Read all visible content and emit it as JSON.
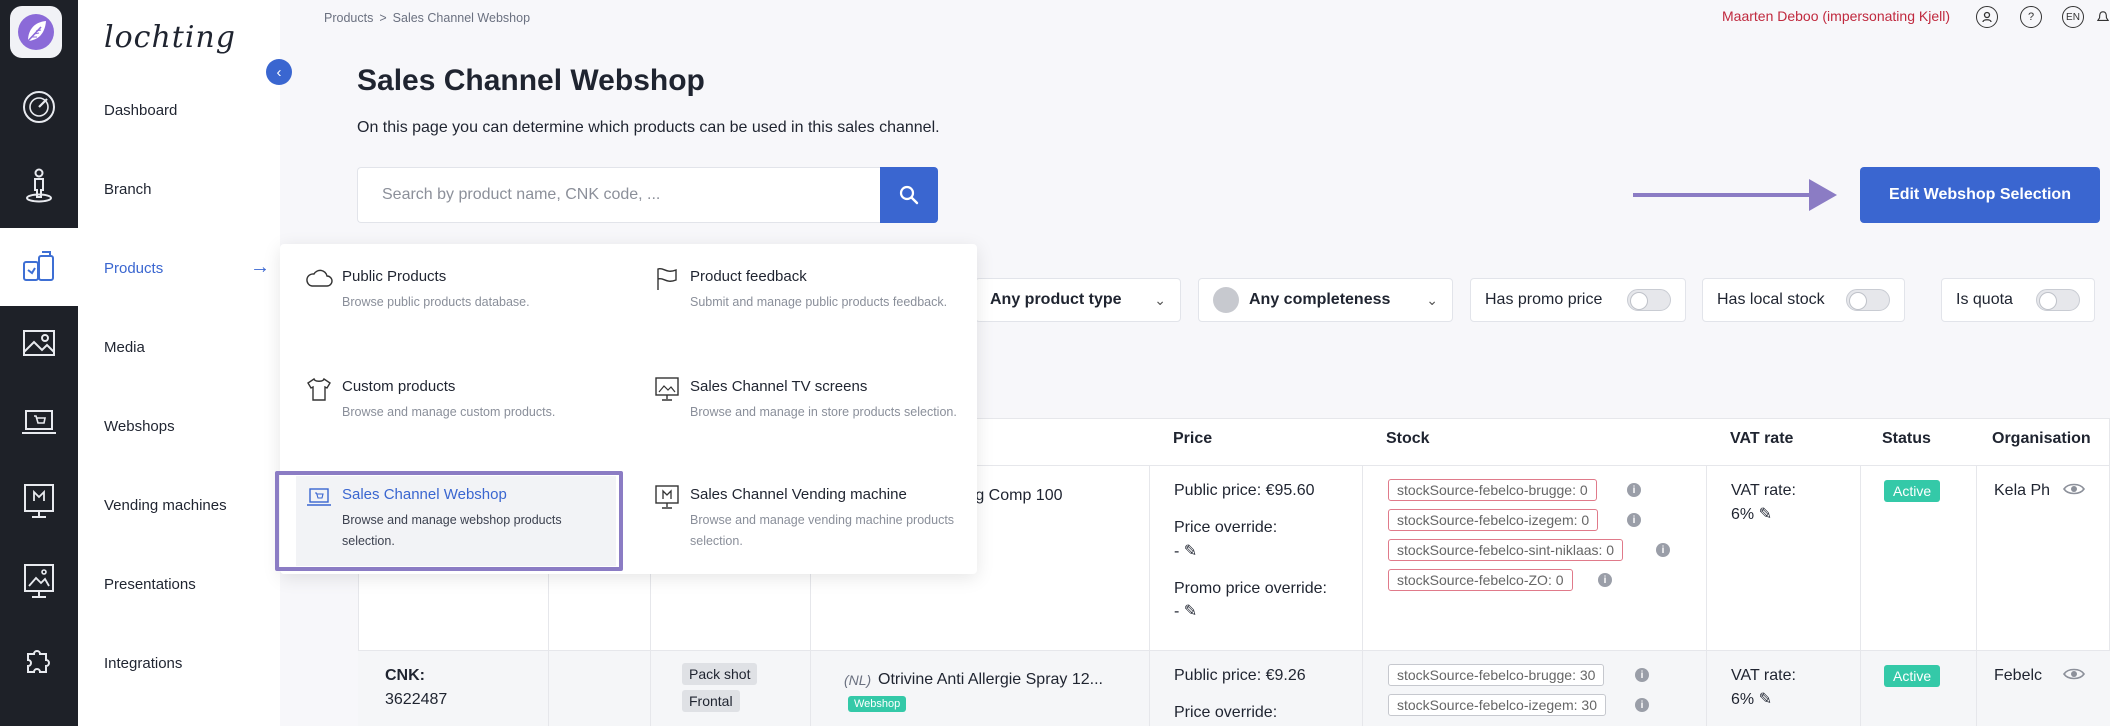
{
  "rail": {
    "icons": [
      "dashboard-gauge-icon",
      "branch-person-icon",
      "products-box-icon",
      "media-image-icon",
      "webshop-laptop-cart-icon",
      "vending-machine-icon",
      "presentation-board-icon",
      "integrations-puzzle-icon"
    ],
    "active_index": 2
  },
  "brand": "lochting",
  "nav": {
    "items": [
      {
        "label": "Dashboard"
      },
      {
        "label": "Branch"
      },
      {
        "label": "Products"
      },
      {
        "label": "Media"
      },
      {
        "label": "Webshops"
      },
      {
        "label": "Vending machines"
      },
      {
        "label": "Presentations"
      },
      {
        "label": "Integrations"
      }
    ],
    "active": "Products"
  },
  "breadcrumb": {
    "parent": "Products",
    "separator": ">",
    "current": "Sales Channel Webshop"
  },
  "topbar": {
    "user": "Maarten Deboo (impersonating Kjell)",
    "help": "?",
    "lang": "EN"
  },
  "page": {
    "title": "Sales Channel Webshop",
    "description": "On this page you can determine which products can be used in this sales channel.",
    "search_placeholder": "Search by product name, CNK code, ...",
    "edit_button": "Edit Webshop Selection"
  },
  "filters": {
    "product_type": "Any product type",
    "completeness": "Any completeness",
    "promo": "Has promo price",
    "local_stock": "Has local stock",
    "quota": "Is quota"
  },
  "dropdown": {
    "items": [
      {
        "title": "Public Products",
        "desc": "Browse public products database.",
        "icon": "cloud-icon"
      },
      {
        "title": "Product feedback",
        "desc": "Submit and manage public products feedback.",
        "icon": "flag-icon"
      },
      {
        "title": "Custom products",
        "desc": "Browse and manage custom products.",
        "icon": "tshirt-icon"
      },
      {
        "title": "Sales Channel TV screens",
        "desc": "Browse and manage in store products selection.",
        "icon": "tv-screen-icon"
      },
      {
        "title": "Sales Channel Webshop",
        "desc": "Browse and manage webshop products selection.",
        "icon": "laptop-cart-icon"
      },
      {
        "title": "Sales Channel Vending machine",
        "desc": "Browse and manage vending machine products selection.",
        "icon": "vending-machine-icon"
      }
    ],
    "selected": "Sales Channel Webshop"
  },
  "table": {
    "headers": {
      "price": "Price",
      "stock": "Stock",
      "vat": "VAT rate",
      "status": "Status",
      "organisation": "Organisation"
    },
    "row1": {
      "name_tail": "mg Comp 100",
      "public_price": "Public price: €95.60",
      "price_override_label": "Price override:",
      "price_override_value": "-",
      "promo_override_label": "Promo price override:",
      "promo_override_value": "-",
      "stock": [
        "stockSource-febelco-brugge: 0",
        "stockSource-febelco-izegem: 0",
        "stockSource-febelco-sint-niklaas: 0",
        "stockSource-febelco-ZO: 0"
      ],
      "vat_label": "VAT rate:",
      "vat_value": "6%",
      "status": "Active",
      "organisation": "Kela Ph"
    },
    "row2": {
      "cnk_label": "CNK:",
      "cnk_value": "3622487",
      "tags": [
        "Pack shot",
        "Frontal"
      ],
      "lang": "(NL)",
      "name": "Otrivine Anti Allergie Spray 12...",
      "badge": "Webshop",
      "public_price": "Public price: €9.26",
      "price_override_label": "Price override:",
      "stock": [
        "stockSource-febelco-brugge: 30",
        "stockSource-febelco-izegem: 30"
      ],
      "vat_label": "VAT rate:",
      "vat_value": "6%",
      "status": "Active",
      "organisation": "Febelc"
    }
  },
  "colors": {
    "primary": "#3a66d0",
    "rail": "#1e2128",
    "highlight": "#8b7cc4",
    "active_badge": "#34c9a8",
    "user": "#c0293e"
  }
}
